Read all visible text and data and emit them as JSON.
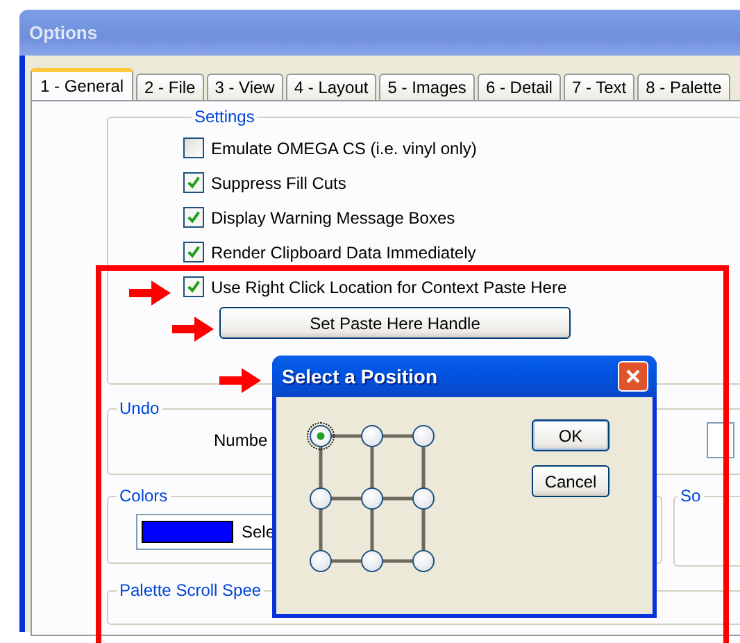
{
  "window": {
    "title": "Options"
  },
  "tabs": [
    {
      "label": "1 - General",
      "selected": true
    },
    {
      "label": "2 - File",
      "selected": false
    },
    {
      "label": "3 - View",
      "selected": false
    },
    {
      "label": "4 - Layout",
      "selected": false
    },
    {
      "label": "5 - Images",
      "selected": false
    },
    {
      "label": "6 - Detail",
      "selected": false
    },
    {
      "label": "7 - Text",
      "selected": false
    },
    {
      "label": "8 - Palette",
      "selected": false
    }
  ],
  "settings": {
    "title": "Settings",
    "options": [
      {
        "label": "Emulate OMEGA CS (i.e. vinyl only)",
        "checked": false
      },
      {
        "label": "Suppress Fill Cuts",
        "checked": true
      },
      {
        "label": "Display Warning Message Boxes",
        "checked": true
      },
      {
        "label": "Render Clipboard Data Immediately",
        "checked": true
      },
      {
        "label": "Use Right Click Location for Context Paste Here",
        "checked": true
      }
    ],
    "button": "Set Paste Here Handle"
  },
  "undo": {
    "title": "Undo",
    "label": "Numbe"
  },
  "colors": {
    "title": "Colors",
    "label": "Sele"
  },
  "side_group": {
    "title": "So"
  },
  "palette_scroll": {
    "title": "Palette Scroll Spee"
  },
  "dialog": {
    "title": "Select a Position",
    "positions": [
      {
        "selected": true
      },
      {
        "selected": false
      },
      {
        "selected": false
      },
      {
        "selected": false
      },
      {
        "selected": false
      },
      {
        "selected": false
      },
      {
        "selected": false
      },
      {
        "selected": false
      },
      {
        "selected": false
      }
    ],
    "buttons": [
      "OK",
      "Cancel"
    ]
  }
}
